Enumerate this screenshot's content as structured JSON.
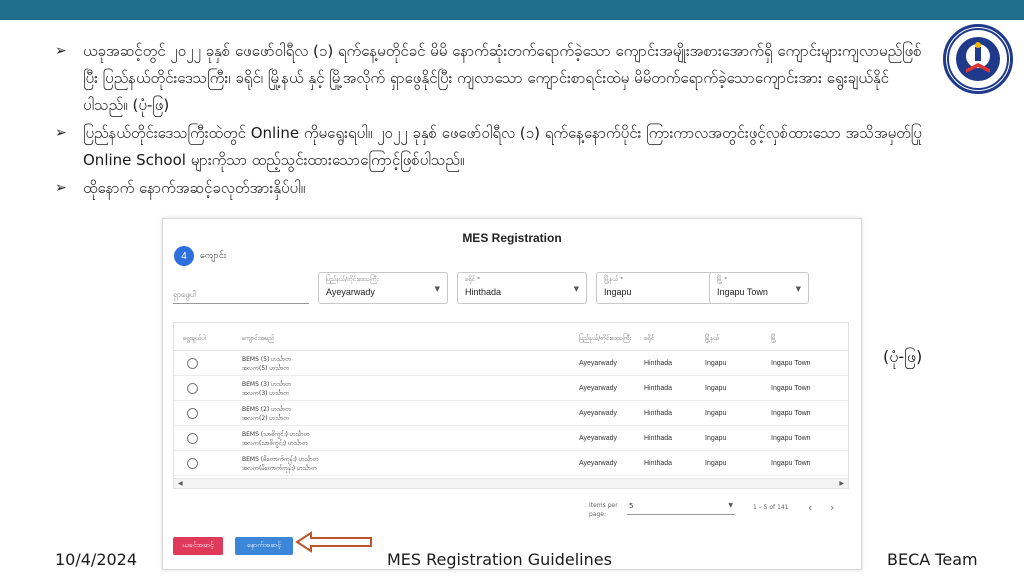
{
  "bullets": [
    "ယခုအဆင့်တွင် ၂၀၂၂ ခုနှစ် ဖေဖော်ဝါရီလ (၁) ရက်နေ့မတိုင်ခင် မိမိ နောက်ဆုံးတက်ရောက်ခဲ့သော ကျောင်းအမျိုးအစားအောက်ရှိ ကျောင်းများကျလာမည်ဖြစ်ပြီး ပြည်နယ်တိုင်းဒေသကြီး၊ ခရိုင်၊ မြို့နယ် နှင့် မြို့အလိုက် ရှာဖွေနိုင်ပြီး ကျလာသော ကျောင်းစာရင်းထဲမှ မိမိတက်ရောက်ခဲ့သောကျောင်းအား ရွေးချယ်နိုင်ပါသည်။ (ပုံ-ဖြ)",
    "ပြည်နယ်တိုင်းဒေသကြီးထဲတွင် Online ကိုမရွေးရပါ။ ၂၀၂၂ ခုနှစ် ဖေဖော်ဝါရီလ (၁) ရက်နေ့နောက်ပိုင်း ကြားကာလအတွင်းဖွင့်လှစ်ထားသော အသိအမှတ်ပြု Online School များကိုသာ ထည့်သွင်းထားသောကြောင့်ဖြစ်ပါသည်။",
    "ထိုနောက် နောက်အဆင့်ခလုတ်အားနှိပ်ပါ။"
  ],
  "bullet_marker": "➢",
  "caption": "(ပုံ-ဖြ)",
  "shot": {
    "title": "MES Registration",
    "step_number": "4",
    "step_label": "ကျောင်း",
    "search_placeholder": "ရှာဖွေပါ",
    "filters": [
      {
        "label": "ပြည်နယ်/တိုင်းဒေသကြီး",
        "value": "Ayeyarwady"
      },
      {
        "label": "ခရိုင် *",
        "value": "Hinthada"
      },
      {
        "label": "မြို့နယ် *",
        "value": "Ingapu"
      },
      {
        "label": "မြို့ *",
        "value": "Ingapu Town"
      }
    ],
    "columns": [
      "ရွေးချယ်ပါ",
      "ကျောင်းအမည်",
      "ပြည်နယ်/တိုင်းဒေသကြီး",
      "ခရိုင်",
      "မြို့နယ်",
      "မြို့"
    ],
    "rows": [
      {
        "name1": "BEMS (5) ဟင်္သာတ",
        "name2": "အလက(5) ဟင်္သာတ",
        "region": "Ayeyarwady",
        "district": "Hinthada",
        "township": "Ingapu",
        "town": "Ingapu Town"
      },
      {
        "name1": "BEMS (3) ဟင်္သာတ",
        "name2": "အလက(3) ဟင်္သာတ",
        "region": "Ayeyarwady",
        "district": "Hinthada",
        "township": "Ingapu",
        "town": "Ingapu Town"
      },
      {
        "name1": "BEMS (2) ဟင်္သာတ",
        "name2": "အလက(2) ဟင်္သာတ",
        "region": "Ayeyarwady",
        "district": "Hinthada",
        "township": "Ingapu",
        "town": "Ingapu Town"
      },
      {
        "name1": "BEMS (သာဓိကွင်း) ဟင်္သာတ",
        "name2": "အလက(သာဓိကွင်း) ဟင်္သာတ",
        "region": "Ayeyarwady",
        "district": "Hinthada",
        "township": "Ingapu",
        "town": "Ingapu Town"
      },
      {
        "name1": "BEMS (မိတောက်ကုန်း) ဟင်္သာတ",
        "name2": "အလက(မိတောက်ကုန်း) ဟင်္သာတ",
        "region": "Ayeyarwady",
        "district": "Hinthada",
        "township": "Ingapu",
        "town": "Ingapu Town"
      }
    ],
    "items_per_page_label": "Items per page:",
    "items_per_page_value": "5",
    "range_text": "1 – 5 of 141",
    "prev_button": "ယခင်အဆင့်",
    "next_button": "နောက်အဆင့်"
  },
  "footer": {
    "date": "10/4/2024",
    "title": "MES Registration Guidelines",
    "team": "BECA Team"
  },
  "colors": {
    "topbar": "#1f6f8b",
    "accent_blue": "#3b86d9",
    "accent_red": "#e03a5a",
    "callout_arrow": "#c0552b"
  }
}
